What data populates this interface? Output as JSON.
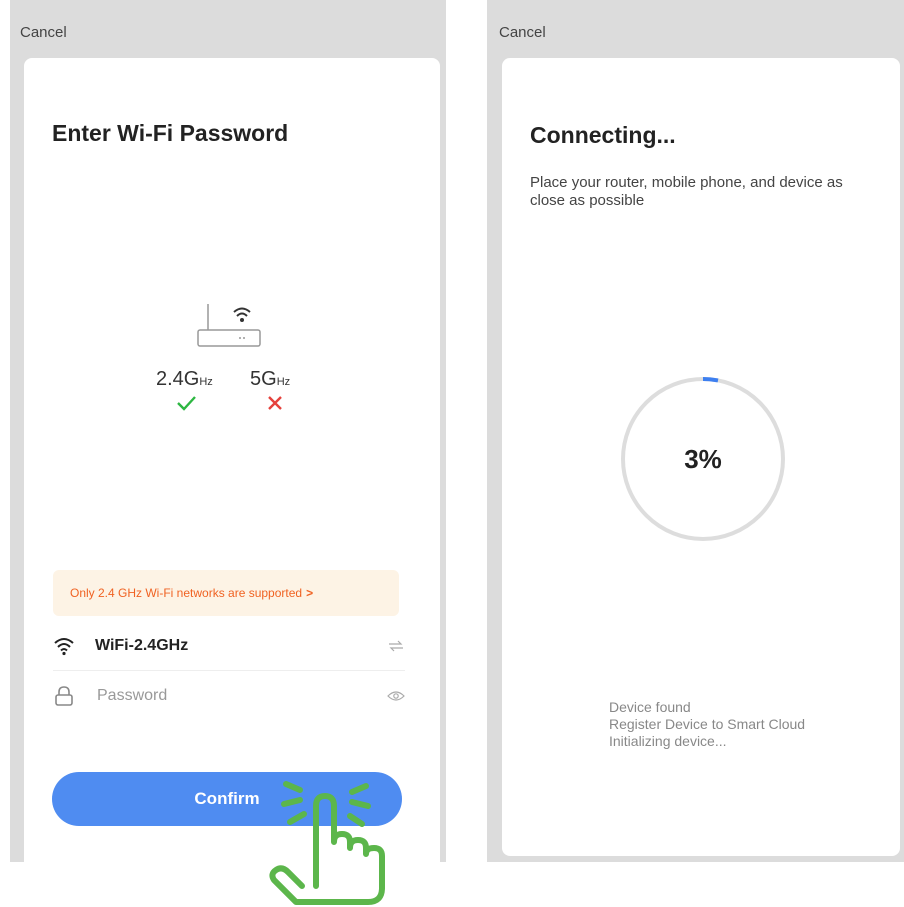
{
  "left_screen": {
    "cancel_label": "Cancel",
    "title": "Enter Wi-Fi Password",
    "bands": {
      "band_24": "2.4G",
      "band_24_unit": "Hz",
      "band_5": "5G",
      "band_5_unit": "Hz",
      "band_24_supported": true,
      "band_5_supported": false
    },
    "notice": {
      "text": "Only 2.4 GHz Wi-Fi networks are supported",
      "arrow": ">"
    },
    "ssid": "WiFi-2.4GHz",
    "password": {
      "value": "",
      "placeholder": "Password"
    },
    "confirm_label": "Confirm",
    "colors": {
      "accent": "#4f8cf1",
      "notice_text": "#f06222",
      "notice_bg": "#fdf3e5",
      "ok": "#2db742",
      "no": "#e5413c",
      "hand": "#5cb64b"
    }
  },
  "right_screen": {
    "cancel_label": "Cancel",
    "title": "Connecting...",
    "subtitle": "Place your router, mobile phone, and device as close as possible",
    "progress": {
      "percent_label": "3%",
      "value": 0.03
    },
    "status_lines": [
      "Device found",
      "Register Device to Smart Cloud",
      "Initializing device..."
    ],
    "colors": {
      "ring": "#dddddd",
      "ring_progress": "#3d7ff0"
    }
  }
}
